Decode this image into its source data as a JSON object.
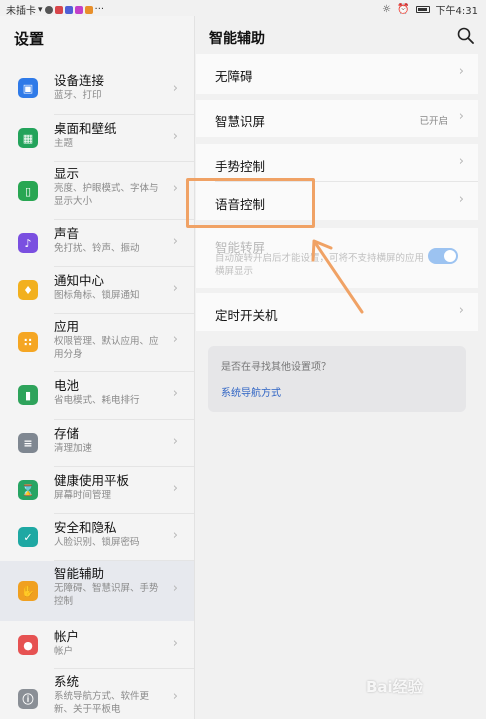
{
  "status_bar": {
    "carrier": "未插卡",
    "more": "···",
    "time": "下午4:31",
    "icons": [
      "wifi-icon",
      "cat-icon",
      "app-icon",
      "app-icon",
      "app-icon",
      "app-icon"
    ]
  },
  "left_panel": {
    "title": "设置",
    "items": [
      {
        "title": "设备连接",
        "subtitle": "蓝牙、打印",
        "icon": "device-icon",
        "color": "#2f7ae8"
      },
      {
        "title": "桌面和壁纸",
        "subtitle": "主题",
        "icon": "wallpaper-icon",
        "color": "#23a35b"
      },
      {
        "title": "显示",
        "subtitle": "亮度、护眼模式、字体与显示大小",
        "icon": "display-icon",
        "color": "#28a652"
      },
      {
        "title": "声音",
        "subtitle": "免打扰、铃声、振动",
        "icon": "sound-icon",
        "color": "#7a4fe0"
      },
      {
        "title": "通知中心",
        "subtitle": "图标角标、锁屏通知",
        "icon": "bell-icon",
        "color": "#f2b01e"
      },
      {
        "title": "应用",
        "subtitle": "权限管理、默认应用、应用分身",
        "icon": "apps-icon",
        "color": "#f5a623"
      },
      {
        "title": "电池",
        "subtitle": "省电模式、耗电排行",
        "icon": "battery-icon",
        "color": "#2ea35b"
      },
      {
        "title": "存储",
        "subtitle": "清理加速",
        "icon": "storage-icon",
        "color": "#7f8791"
      },
      {
        "title": "健康使用平板",
        "subtitle": "屏幕时间管理",
        "icon": "hourglass-icon",
        "color": "#27a463"
      },
      {
        "title": "安全和隐私",
        "subtitle": "人脸识别、锁屏密码",
        "icon": "shield-icon",
        "color": "#1ea8a3"
      },
      {
        "title": "智能辅助",
        "subtitle": "无障碍、智慧识屏、手势控制",
        "icon": "hand-icon",
        "color": "#f0a020"
      },
      {
        "title": "帐户",
        "subtitle": "帐户",
        "icon": "account-icon",
        "color": "#e65252"
      },
      {
        "title": "系统",
        "subtitle": "系统导航方式、软件更新、关于平板电",
        "icon": "system-icon",
        "color": "#8a8f96"
      }
    ]
  },
  "right_panel": {
    "title": "智能辅助",
    "rows": [
      {
        "label": "无障碍"
      },
      {
        "label": "智慧识屏",
        "value": "已开启"
      },
      {
        "label": "手势控制"
      },
      {
        "label": "语音控制"
      },
      {
        "label": "智能转屏",
        "desc": "自动旋转开启后才能设置，可将不支持横屏的应用横屏显示",
        "toggle_on": true
      },
      {
        "label": "定时开关机"
      }
    ],
    "hint": {
      "question": "是否在寻找其他设置项？",
      "link": "系统导航方式"
    }
  },
  "annotation": {
    "highlight_color": "#f0a265"
  },
  "watermark": "Bai经验"
}
